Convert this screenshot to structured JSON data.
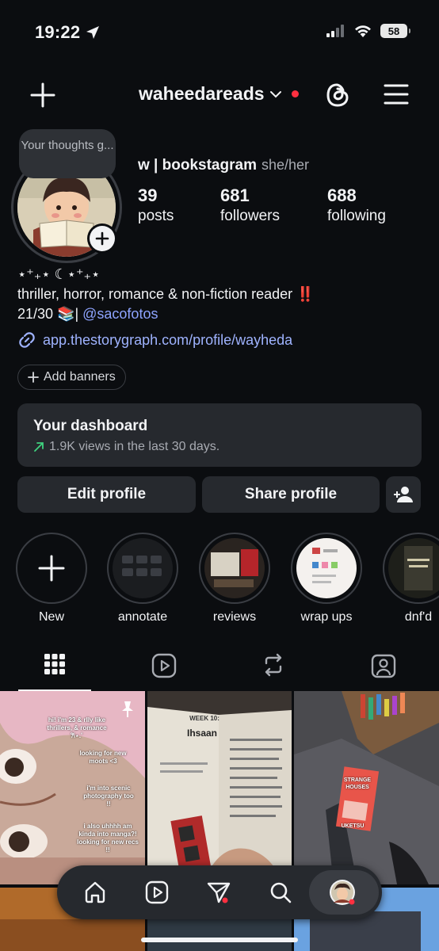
{
  "status_bar": {
    "time": "19:22",
    "battery": "58"
  },
  "header": {
    "username": "waheedareads"
  },
  "note": {
    "text": "Your thoughts g..."
  },
  "profile": {
    "display_name": "w | bookstagram",
    "pronouns": "she/her",
    "stats": [
      {
        "value": "39",
        "label": "posts"
      },
      {
        "value": "681",
        "label": "followers"
      },
      {
        "value": "688",
        "label": "following"
      }
    ],
    "bio_line1": "⋆⁺₊⋆ ☾⋆⁺₊⋆",
    "bio_line2": "thriller, horror, romance & non-fiction reader ‼️",
    "bio_line3_prefix": "21/30 📚| ",
    "bio_mention": "@sacofotos",
    "link": "app.thestorygraph.com/profile/wayheda",
    "add_banners": "Add banners"
  },
  "dashboard": {
    "title": "Your dashboard",
    "subtitle": "1.9K views in the last 30 days."
  },
  "actions": {
    "edit": "Edit profile",
    "share": "Share profile"
  },
  "highlights": [
    {
      "label": "New"
    },
    {
      "label": "annotate"
    },
    {
      "label": "reviews"
    },
    {
      "label": "wrap ups"
    },
    {
      "label": "dnf'd"
    }
  ],
  "posts": {
    "post1_lines": [
      "hi! i'm 23 & rlly like thrillers, & romance 𐙚⋆.˚",
      "looking for new moots <3",
      "i'm into scenic photography too !!",
      "i also uhhhh am kinda into manga?! looking for new recs !!"
    ],
    "post2_heading": "WEEK 10:",
    "post2_name": "Ihsaan",
    "post3_book_title": "STRANGE HOUSES",
    "post3_book_author": "UKETSU"
  },
  "colors": {
    "background": "#0b0d10",
    "surface": "#26292e",
    "notification_red": "#ff3040",
    "link": "#9fb3ff",
    "trend_green": "#3fd27f"
  }
}
